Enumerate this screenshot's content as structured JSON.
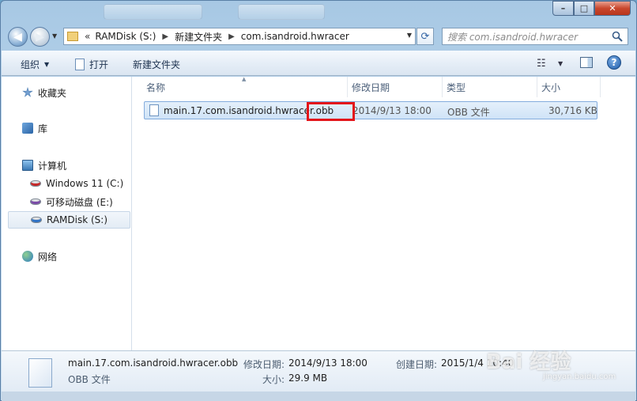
{
  "window": {
    "minimize": "–",
    "maximize": "□",
    "close": "✕"
  },
  "address": {
    "overflow": "«",
    "crumbs": [
      "RAMDisk (S:)",
      "新建文件夹",
      "com.isandroid.hwracer"
    ],
    "separator": "▶"
  },
  "search": {
    "placeholder": "搜索 com.isandroid.hwracer"
  },
  "toolbar": {
    "organize": "组织",
    "open": "打开",
    "new_folder": "新建文件夹"
  },
  "nav": {
    "favorites": "收藏夹",
    "libraries": "库",
    "computer": "计算机",
    "drives": [
      "Windows 11 (C:)",
      "可移动磁盘 (E:)",
      "RAMDisk (S:)"
    ],
    "network": "网络"
  },
  "columns": {
    "name": "名称",
    "modified": "修改日期",
    "type": "类型",
    "size": "大小"
  },
  "files": [
    {
      "name": "main.17.com.isandroid.hwracer.obb",
      "modified": "2014/9/13 18:00",
      "type": "OBB 文件",
      "size": "30,716 KB"
    }
  ],
  "details": {
    "filename": "main.17.com.isandroid.hwracer.obb",
    "filetype": "OBB 文件",
    "modified_label": "修改日期:",
    "modified_value": "2014/9/13 18:00",
    "created_label": "创建日期:",
    "created_value": "2015/1/4 10:40",
    "size_label": "大小:",
    "size_value": "29.9 MB"
  },
  "watermark": {
    "text": "Bai 经验",
    "url": "jingyan.baidu.com"
  },
  "colors": {
    "highlight": "#e4161b",
    "selection": "#cfe3f7",
    "close_button": "#c9472d"
  }
}
